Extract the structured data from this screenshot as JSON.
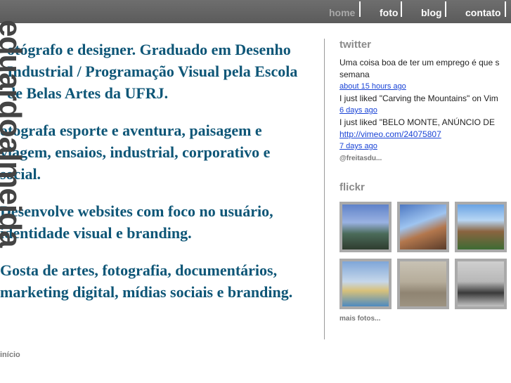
{
  "nav": {
    "items": [
      {
        "label": "home",
        "active": true
      },
      {
        "label": "foto",
        "active": false
      },
      {
        "label": "blog",
        "active": false
      },
      {
        "label": "contato",
        "active": false
      }
    ]
  },
  "brand": "eduardoalmeida",
  "main": {
    "paragraphs": [
      "otógrafo e designer. Graduado em Desenho Industrial / Programação Visual pela Escola de Belas Artes da UFRJ.",
      "otografa esporte e aventura, paisagem e viagem, ensaios, industrial, corporativo e social.",
      "Desenvolve websites com foco no usuário, identidade visual e branding.",
      "Gosta de artes, fotografia, documentários, marketing digital, mídias sociais e branding."
    ],
    "footer_link": "início"
  },
  "twitter": {
    "heading": "twitter",
    "tweet1_text": "Uma coisa boa de ter um emprego é que s semana",
    "tweet1_time": "about 15 hours ago",
    "tweet2_text": "I just liked \"Carving the Mountains\" on Vim",
    "tweet2_time": "6 days ago",
    "tweet3_text": "I just liked \"BELO MONTE, ANÚNCIO DE",
    "tweet3_link": "http://vimeo.com/24075807",
    "tweet3_time": "7 days ago",
    "more": "@freitasdu..."
  },
  "flickr": {
    "heading": "flickr",
    "more": "mais fotos..."
  }
}
